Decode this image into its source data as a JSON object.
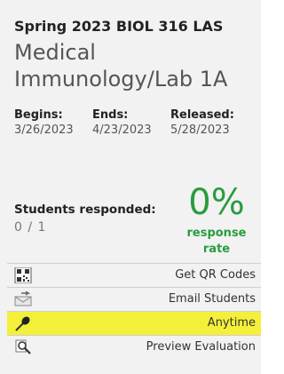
{
  "card": {
    "term": "Spring 2023 BIOL 316 LAS",
    "course_title": "Medical Immunology/Lab 1A",
    "dates": {
      "begins_label": "Begins:",
      "begins": "3/26/2023",
      "ends_label": "Ends:",
      "ends": "4/23/2023",
      "released_label": "Released:",
      "released": "5/28/2023"
    },
    "responses": {
      "label": "Students responded:",
      "count": "0 / 1",
      "percent": "0%",
      "rate_line1": "response",
      "rate_line2": "rate"
    }
  },
  "actions": [
    {
      "label": "Get QR Codes",
      "icon": "qr-code-icon"
    },
    {
      "label": "Email Students",
      "icon": "email-icon"
    },
    {
      "label": "Anytime",
      "icon": "pin-icon"
    },
    {
      "label": "Preview Evaluation",
      "icon": "magnifier-icon"
    }
  ],
  "colors": {
    "accent_green": "#2a9c3d",
    "highlight_yellow": "#f4f03a",
    "card_bg": "#f2f2f2"
  }
}
